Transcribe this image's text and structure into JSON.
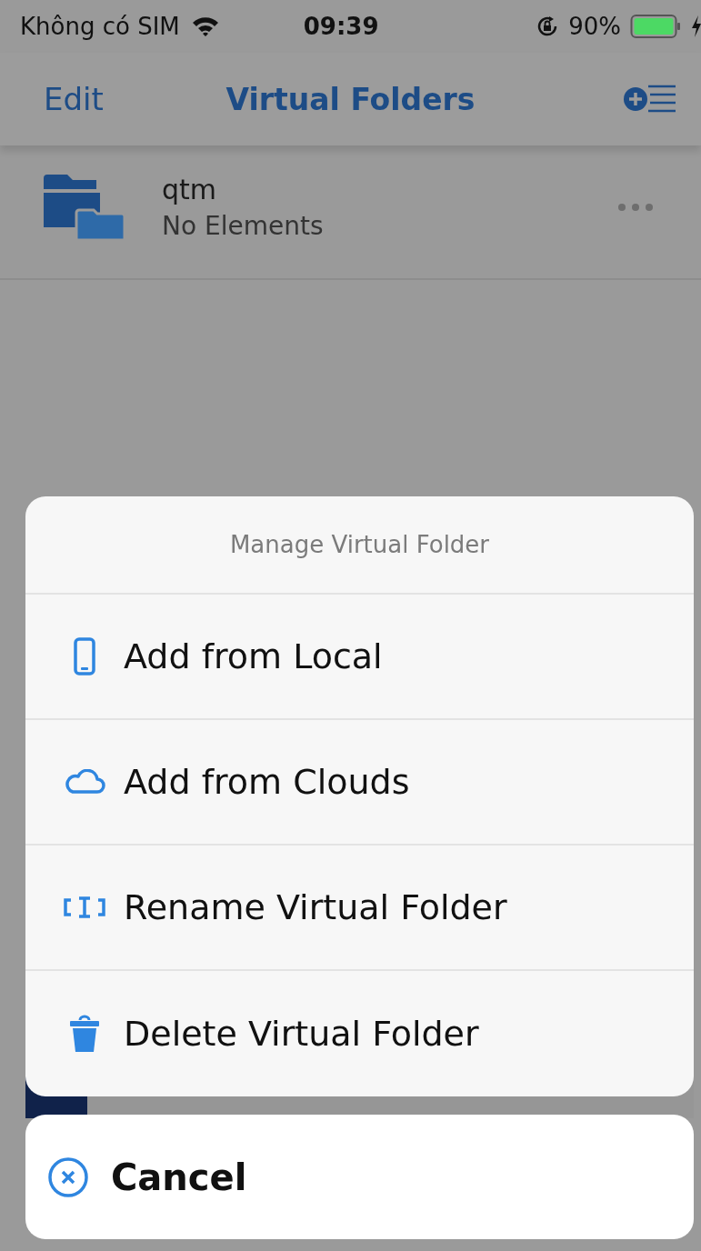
{
  "status_bar": {
    "carrier": "Không có SIM",
    "time": "09:39",
    "battery": "90%"
  },
  "nav_bar": {
    "left_button": "Edit",
    "title": "Virtual Folders"
  },
  "folders": [
    {
      "name": "qtm",
      "subtitle": "No Elements"
    }
  ],
  "action_sheet": {
    "title": "Manage Virtual Folder",
    "actions": [
      {
        "label": "Add from Local",
        "kind": "phone"
      },
      {
        "label": "Add from Clouds",
        "kind": "cloud"
      },
      {
        "label": "Rename Virtual Folder",
        "kind": "rename"
      },
      {
        "label": "Delete Virtual Folder",
        "kind": "trash"
      }
    ],
    "cancel": "Cancel"
  }
}
